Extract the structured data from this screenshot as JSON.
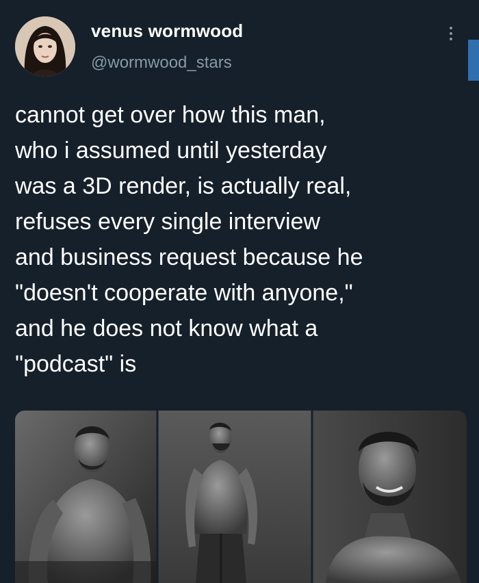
{
  "tweet": {
    "display_name": "venus wormwood",
    "handle": "@wormwood_stars",
    "text": "cannot get over how this man,\nwho i assumed until yesterday\nwas a 3D render, is actually real,\nrefuses every single interview\nand business request because he\n\"doesn't cooperate with anyone,\"\nand he does not know what a\n\"podcast\" is",
    "more_icon": "more-vertical-icon",
    "media": [
      "photo-seated-man",
      "photo-standing-man",
      "photo-smiling-man"
    ]
  },
  "colors": {
    "background": "#15202b",
    "text": "#ffffff",
    "secondary_text": "#8899a6",
    "accent": "#2f6fb0"
  }
}
